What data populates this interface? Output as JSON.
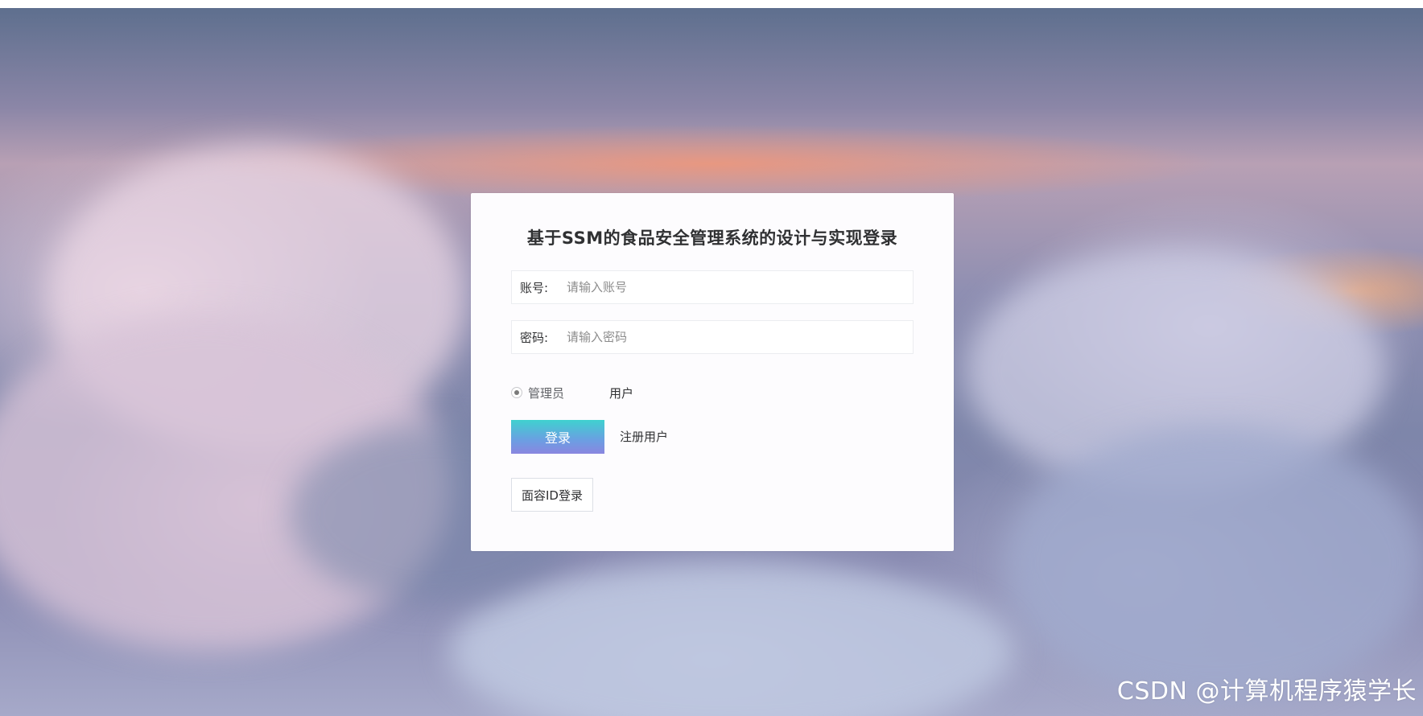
{
  "login": {
    "title": "基于SSM的食品安全管理系统的设计与实现登录",
    "account_label": "账号:",
    "account_placeholder": "请输入账号",
    "account_value": "",
    "password_label": "密码:",
    "password_placeholder": "请输入密码",
    "password_value": "",
    "roles": [
      {
        "label": "管理员",
        "selected": true
      },
      {
        "label": "用户",
        "selected": false
      }
    ],
    "login_button": "登录",
    "register_link": "注册用户",
    "face_login_button": "面容ID登录"
  },
  "watermark": "CSDN @计算机程序猿学长",
  "colors": {
    "card_bg": "#fdfcfe",
    "login_button_top": "#3fd1cf",
    "login_button_bottom": "#8a86e0"
  }
}
